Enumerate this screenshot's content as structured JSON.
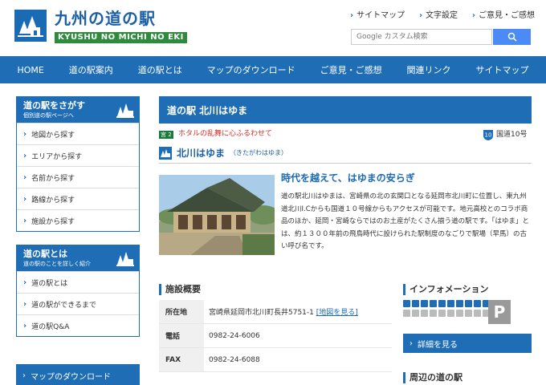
{
  "header": {
    "title": "九州の道の駅",
    "subtitle": "KYUSHU NO MICHI NO EKI",
    "links": [
      "サイトマップ",
      "文字設定",
      "ご意見・ご感想"
    ],
    "search_placeholder": "Google カスタム検索"
  },
  "nav": {
    "items": [
      "HOME",
      "道の駅案内",
      "道の駅とは",
      "マップのダウンロード",
      "ご意見・ご感想",
      "関連リンク",
      "サイトマップ"
    ]
  },
  "sidebar": {
    "search_box": {
      "title": "道の駅をさがす",
      "desc": "個別道の駅ページへ",
      "items": [
        "地図から探す",
        "エリアから探す",
        "名前から探す",
        "路線から探す",
        "施設から探す"
      ]
    },
    "about_box": {
      "title": "道の駅とは",
      "desc": "道の駅のことを詳しく紹介",
      "items": [
        "道の駅とは",
        "道の駅ができるまで",
        "道の駅Q&A"
      ]
    },
    "map_download": "マップのダウンロード"
  },
  "main": {
    "title": "道の駅 北川はゆま",
    "route_badge": "宮 2",
    "catch_small": "ホタルの乱舞に心ふるわせて",
    "route_number": "10",
    "route_label": "国道10号",
    "station_name": "北川はゆま",
    "station_kana": "（きたがわはゆま）",
    "catch": "時代を越えて、はゆまの安らぎ",
    "description": "道の駅北川はゆまは、宮崎県の北の玄関口となる延岡市北川町に位置し、東九州道北川I.Cからも国道１０号線からもアクセスが可能です。地元高校とのコラボ商品のほか、延岡・宮崎ならではのお土産がたくさん揃う道の駅です。「はゆま」とは、約１３００年前の飛鳥時代に設けられた駅制度のなごりで駅場（早馬）の古い呼び名です。",
    "facility": {
      "title": "施設概要",
      "address_label": "所在地",
      "address": "宮崎県延岡市北川町長井5751-1",
      "map_link": "[地図を見る]",
      "phone_label": "電話",
      "phone": "0982-24-6006",
      "fax_label": "FAX",
      "fax": "0982-24-6088"
    },
    "info": {
      "title": "インフォメーション",
      "detail_button": "詳細を見る"
    },
    "nearby_title": "周辺の道の駅"
  },
  "colors": {
    "primary": "#1f6eb5",
    "accent_green": "#2e8b3c",
    "catch_red": "#d0302a"
  }
}
